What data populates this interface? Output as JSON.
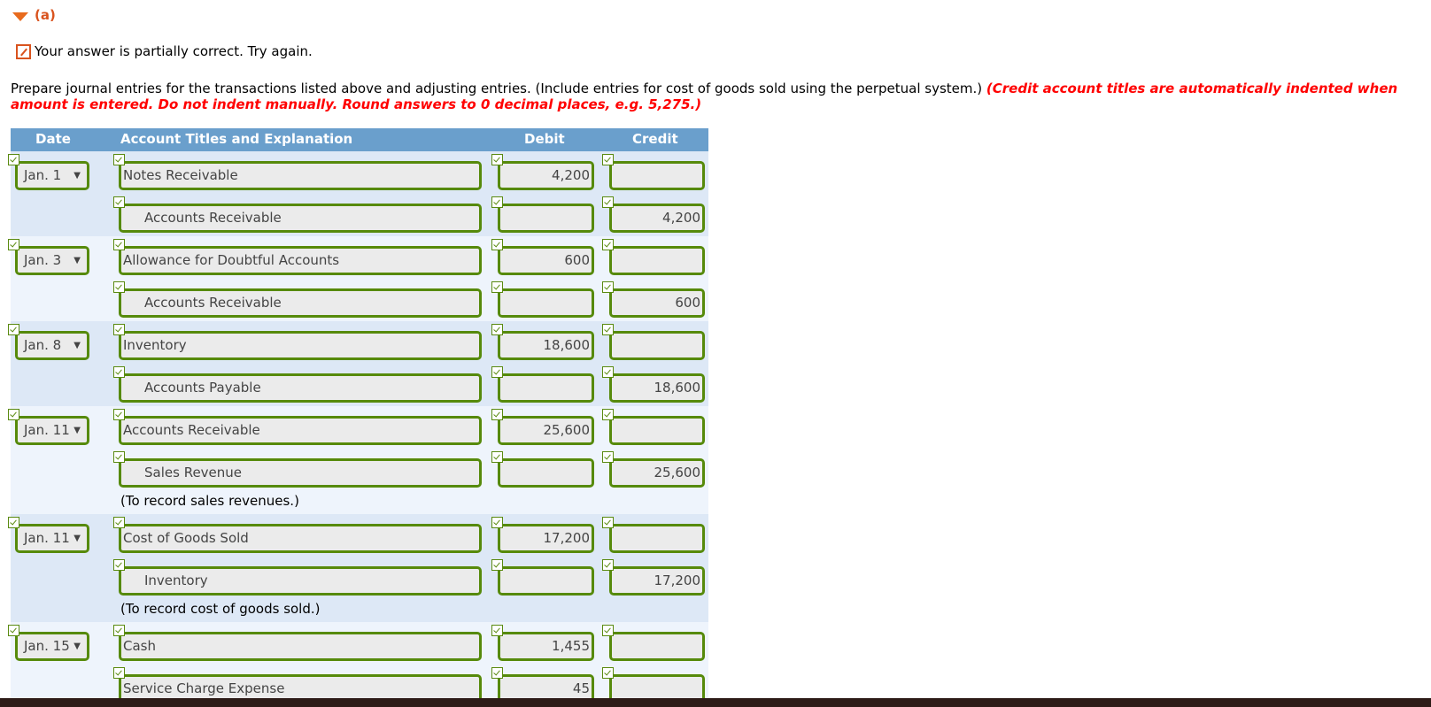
{
  "section": {
    "label": "(a)"
  },
  "status": {
    "message": "Your answer is partially correct.  Try again.",
    "icon": "pencil-icon",
    "color": "#d9531e"
  },
  "instructions": {
    "text": "Prepare journal entries for the transactions listed above and adjusting entries. (Include entries for cost of goods sold using the perpetual system.) ",
    "emphasis": "(Credit account titles are automatically indented when amount is entered. Do not indent manually. Round answers to 0 decimal places, e.g. 5,275.)"
  },
  "table": {
    "headers": {
      "date": "Date",
      "account": "Account Titles and Explanation",
      "debit": "Debit",
      "credit": "Credit"
    },
    "entries": [
      {
        "date": "Jan. 1",
        "lines": [
          {
            "account": "Notes Receivable",
            "debit": "4,200",
            "credit": ""
          },
          {
            "account": "Accounts Receivable",
            "debit": "",
            "credit": "4,200"
          }
        ],
        "note": ""
      },
      {
        "date": "Jan. 3",
        "lines": [
          {
            "account": "Allowance for Doubtful Accounts",
            "debit": "600",
            "credit": ""
          },
          {
            "account": "Accounts Receivable",
            "debit": "",
            "credit": "600"
          }
        ],
        "note": ""
      },
      {
        "date": "Jan. 8",
        "lines": [
          {
            "account": "Inventory",
            "debit": "18,600",
            "credit": ""
          },
          {
            "account": "Accounts Payable",
            "debit": "",
            "credit": "18,600"
          }
        ],
        "note": ""
      },
      {
        "date": "Jan. 11",
        "lines": [
          {
            "account": "Accounts Receivable",
            "debit": "25,600",
            "credit": ""
          },
          {
            "account": "Sales Revenue",
            "debit": "",
            "credit": "25,600"
          }
        ],
        "note": "(To record sales revenues.)"
      },
      {
        "date": "Jan. 11",
        "lines": [
          {
            "account": "Cost of Goods Sold",
            "debit": "17,200",
            "credit": ""
          },
          {
            "account": "Inventory",
            "debit": "",
            "credit": "17,200"
          }
        ],
        "note": "(To record cost of goods sold.)"
      },
      {
        "date": "Jan. 15",
        "lines": [
          {
            "account": "Cash",
            "debit": "1,455",
            "credit": ""
          },
          {
            "account": "Service Charge Expense",
            "debit": "45",
            "credit": ""
          }
        ],
        "note": ""
      }
    ]
  },
  "colors": {
    "header_bg": "#6a9fcc",
    "field_border": "#568a0b",
    "error_red": "#ff0000",
    "accent_orange": "#d9531e"
  }
}
